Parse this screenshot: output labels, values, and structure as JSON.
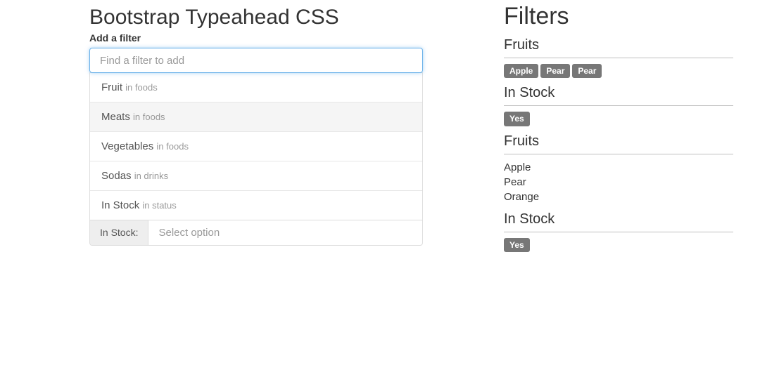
{
  "left": {
    "title": "Bootstrap Typeahead CSS",
    "label": "Add a filter",
    "search": {
      "placeholder": "Find a filter to add"
    },
    "suggestions": [
      {
        "name": "Fruit",
        "secondary": "in foods",
        "active": false
      },
      {
        "name": "Meats",
        "secondary": "in foods",
        "active": true
      },
      {
        "name": "Vegetables",
        "secondary": "in foods",
        "active": false
      },
      {
        "name": "Sodas",
        "secondary": "in drinks",
        "active": false
      },
      {
        "name": "In Stock",
        "secondary": "in status",
        "active": false
      }
    ],
    "instock": {
      "label_text": "In Stock:",
      "placeholder": "Select option"
    }
  },
  "right": {
    "title": "Filters",
    "sections": [
      {
        "head": "Fruits",
        "tags": [
          "Apple",
          "Pear",
          "Pear"
        ]
      },
      {
        "head": "In Stock",
        "tags": [
          "Yes"
        ]
      },
      {
        "head": "Fruits",
        "list": [
          "Apple",
          "Pear",
          "Orange"
        ]
      },
      {
        "head": "In Stock",
        "tags": [
          "Yes"
        ]
      }
    ]
  }
}
